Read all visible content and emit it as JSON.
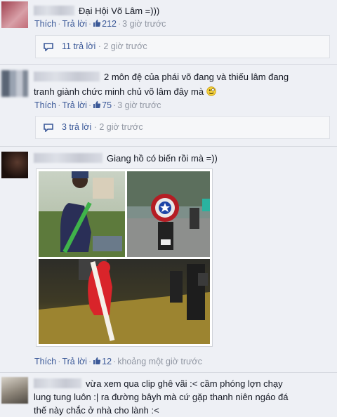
{
  "comments": [
    {
      "text": "Đại Hội Võ Lâm =)))",
      "like_label": "Thích",
      "reply_label": "Trả lời",
      "likes": "212",
      "time": "3 giờ trước",
      "reply_count": "11 trả lời",
      "reply_time": "2 giờ trước"
    },
    {
      "text_line1": "2 môn đệ của phái võ đang và thiếu lâm đang",
      "text_line2": "tranh giành chức minh chủ võ lâm đây mà",
      "like_label": "Thích",
      "reply_label": "Trả lời",
      "likes": "75",
      "time": "3 giờ trước",
      "reply_count": "3 trả lời",
      "reply_time": "2 giờ trước"
    },
    {
      "text": "Giang hồ có biến rồi mà =))",
      "like_label": "Thích",
      "reply_label": "Trả lời",
      "likes": "12",
      "time": "khoảng một giờ trước"
    },
    {
      "text_line1": "vừa xem qua clip ghê vãi :< cầm phóng lợn chạy",
      "text_line2": "lung tung luôn :| ra đường bâyh mà cứ gặp thanh niên ngáo đá",
      "text_line3": "thế này chắc ở nhà cho lành :<"
    }
  ],
  "colors": {
    "link": "#3b5998",
    "meta": "#9197a3",
    "background": "#eef0f5"
  }
}
